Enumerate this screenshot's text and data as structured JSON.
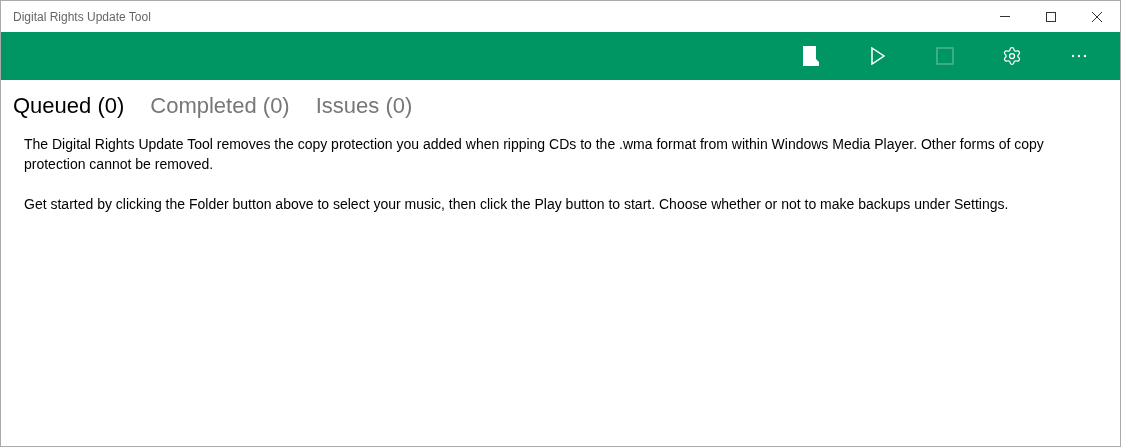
{
  "window": {
    "title": "Digital Rights Update Tool"
  },
  "toolbar": [
    {
      "kind": "folder",
      "disabled": false
    },
    {
      "kind": "play",
      "disabled": false
    },
    {
      "kind": "stop",
      "disabled": true
    },
    {
      "kind": "settings",
      "disabled": false
    },
    {
      "kind": "more",
      "disabled": false
    }
  ],
  "tabs": [
    {
      "label": "Queued (0)",
      "selected": true
    },
    {
      "label": "Completed (0)",
      "selected": false
    },
    {
      "label": "Issues (0)",
      "selected": false
    }
  ],
  "paragraphs": [
    "The Digital Rights Update Tool removes the copy protection you added when ripping CDs to the .wma format from within Windows Media Player. Other forms of copy protection cannot be removed.",
    "Get started by clicking the Folder button above to select your music, then click the Play button to start. Choose whether or not to make backups under Settings."
  ]
}
